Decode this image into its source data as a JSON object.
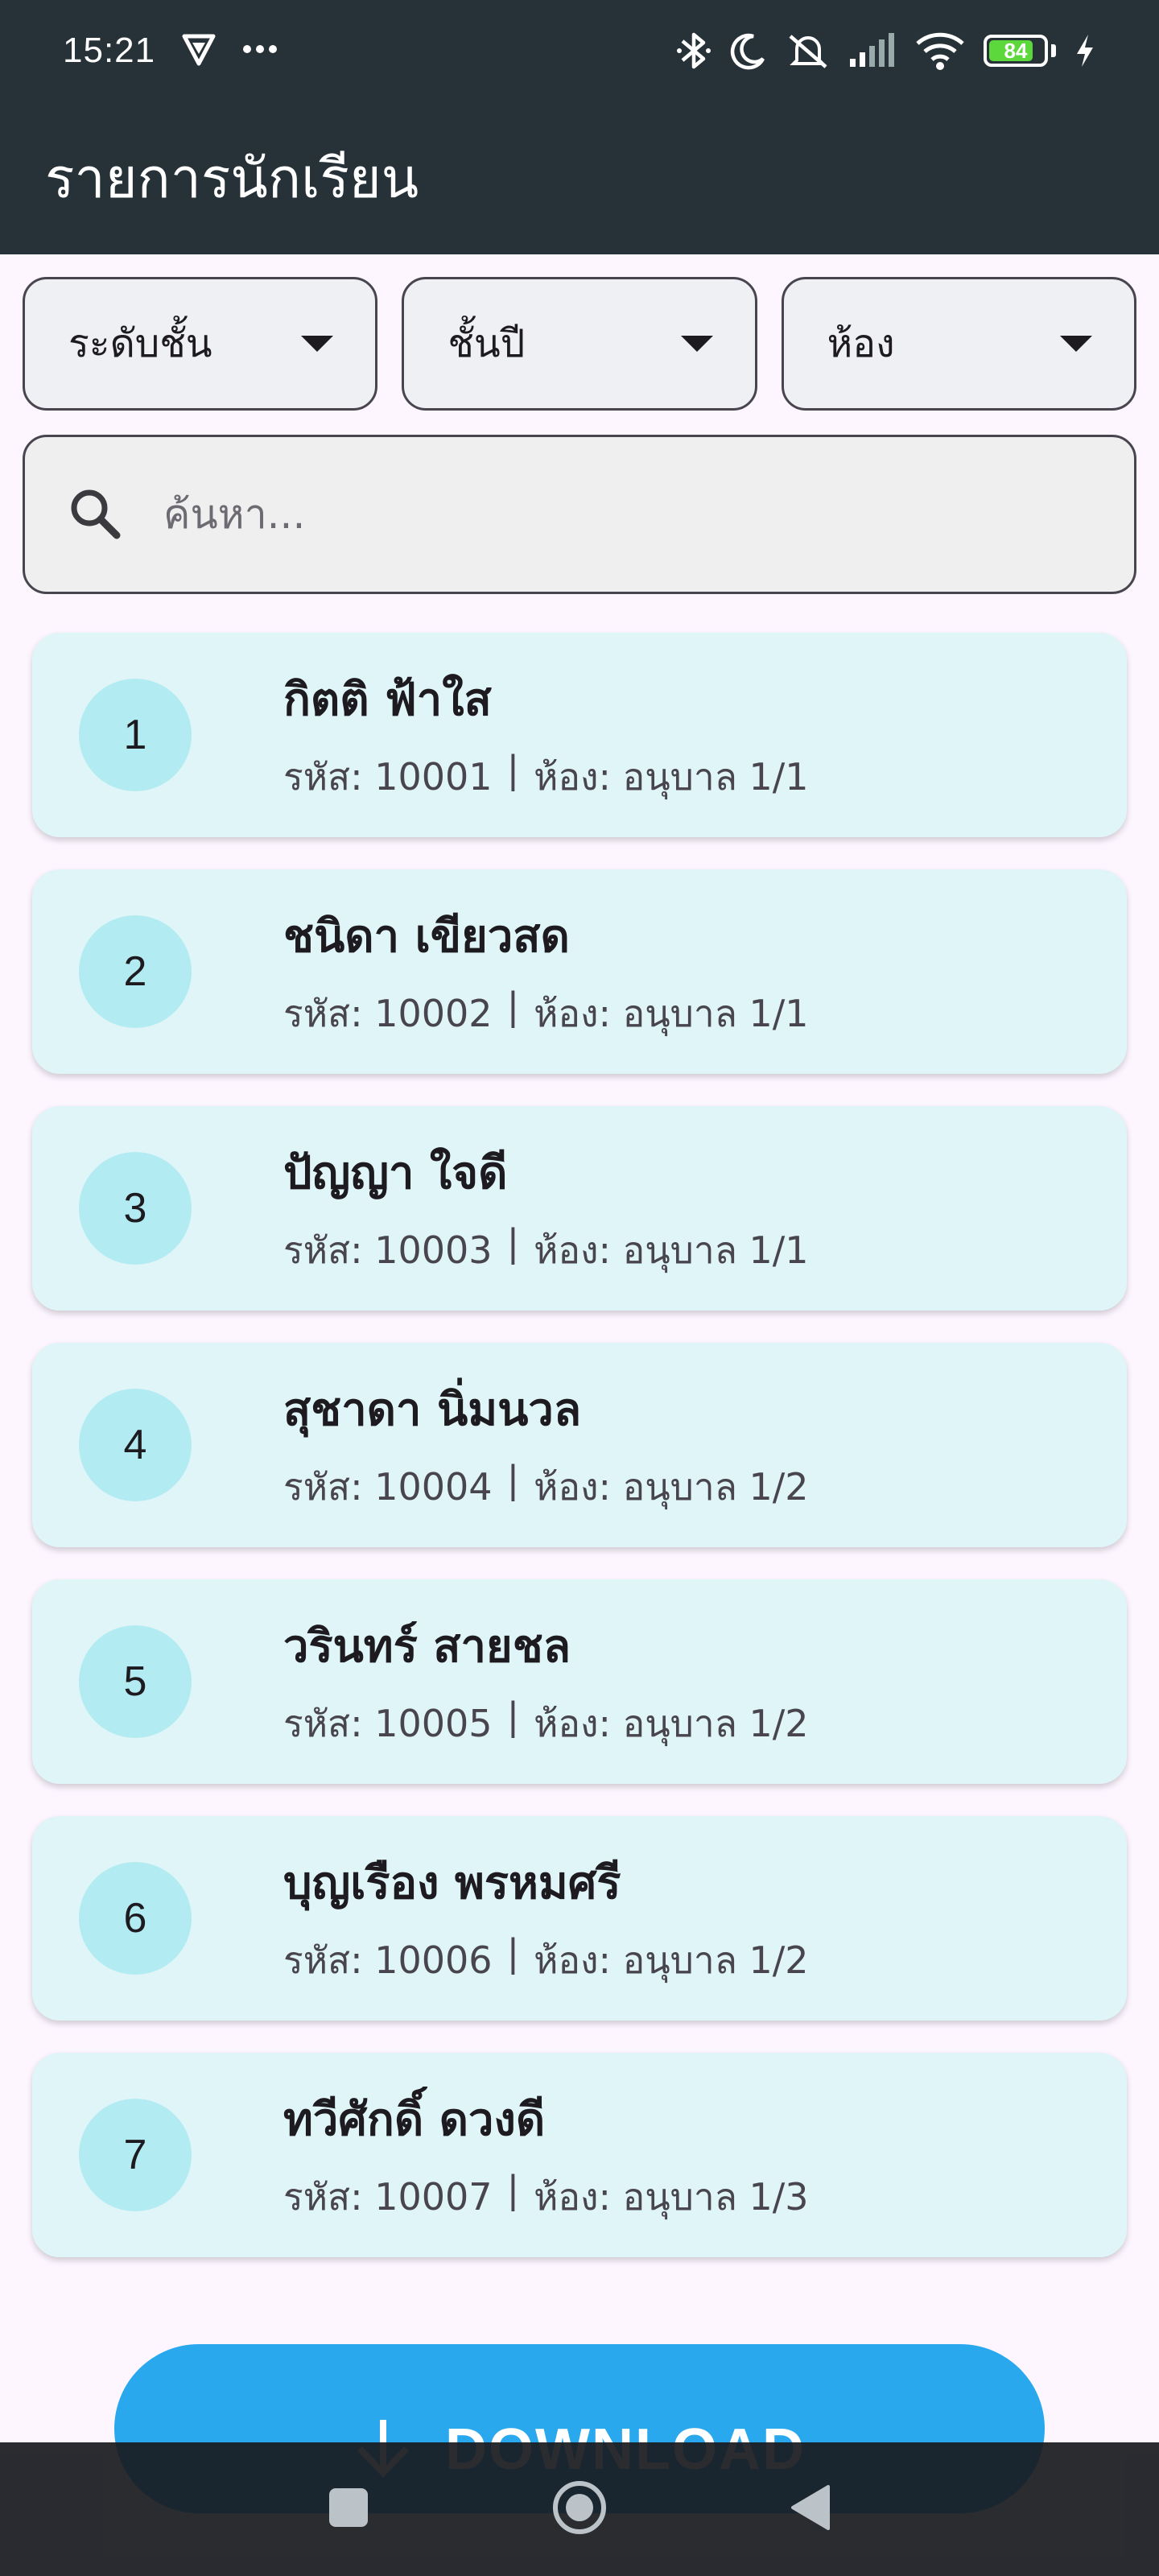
{
  "status_bar": {
    "time": "15:21",
    "battery_level": "84",
    "icons": [
      "shield-icon",
      "more-dots-icon",
      "bluetooth-icon",
      "moon-icon",
      "mute-icon",
      "signal-icon",
      "wifi-icon",
      "battery-icon",
      "charging-icon"
    ]
  },
  "app_bar": {
    "title": "รายการนักเรียน"
  },
  "filters": {
    "level": "ระดับชั้น",
    "year": "ชั้นปี",
    "room": "ห้อง"
  },
  "search": {
    "placeholder": "ค้นหา..."
  },
  "students": [
    {
      "no": "1",
      "name": "กิตติ ฟ้าใส",
      "code": "รหัส: 10001",
      "room": "ห้อง: อนุบาล 1/1"
    },
    {
      "no": "2",
      "name": "ชนิดา เขียวสด",
      "code": "รหัส: 10002",
      "room": "ห้อง: อนุบาล 1/1"
    },
    {
      "no": "3",
      "name": "ปัญญา ใจดี",
      "code": "รหัส: 10003",
      "room": "ห้อง: อนุบาล 1/1"
    },
    {
      "no": "4",
      "name": "สุชาดา นิ่มนวล",
      "code": "รหัส: 10004",
      "room": "ห้อง: อนุบาล 1/2"
    },
    {
      "no": "5",
      "name": "วรินทร์ สายชล",
      "code": "รหัส: 10005",
      "room": "ห้อง: อนุบาล 1/2"
    },
    {
      "no": "6",
      "name": "บุญเรือง พรหมศรี",
      "code": "รหัส: 10006",
      "room": "ห้อง: อนุบาล 1/2"
    },
    {
      "no": "7",
      "name": "ทวีศักดิ์ ดวงดี",
      "code": "รหัส: 10007",
      "room": "ห้อง: อนุบาล 1/3"
    }
  ],
  "separator": "|",
  "download": {
    "label": "DOWNLOAD"
  },
  "colors": {
    "app_bar": "#263238",
    "card": "#dff5f8",
    "avatar": "#b2ebf2",
    "download": "#29a8ee"
  }
}
